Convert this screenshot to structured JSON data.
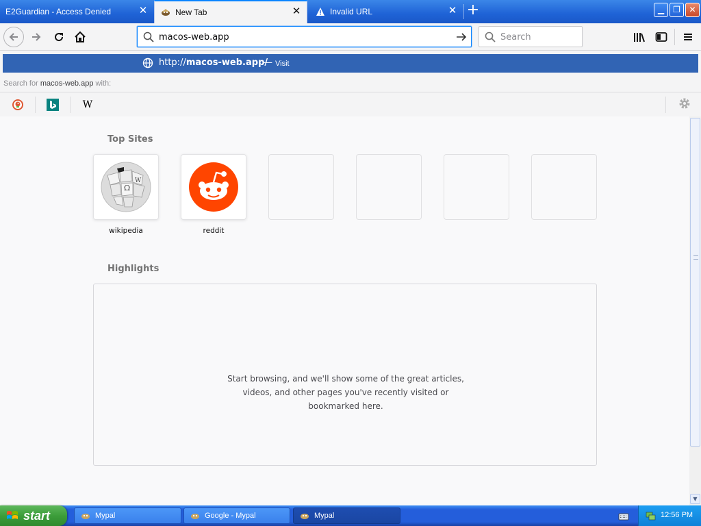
{
  "tabs": [
    {
      "title": "E2Guardian - Access Denied",
      "active": false
    },
    {
      "title": "New Tab",
      "active": true
    },
    {
      "title": "Invalid URL",
      "active": false
    }
  ],
  "window_controls": {
    "minimize": "▁",
    "restore": "❐",
    "close": "✕"
  },
  "urlbar": {
    "value": "macos-web.app"
  },
  "searchbar": {
    "placeholder": "Search"
  },
  "dropdown": {
    "suggestion_prefix": "http://",
    "suggestion_host": "macos-web.app/",
    "suggestion_dash": "—",
    "suggestion_action": "Visit",
    "search_for_prefix": "Search for",
    "search_for_query": "macos-web.app",
    "search_for_suffix": "with:",
    "engines": [
      {
        "name": "DuckDuckGo",
        "icon": "duckduckgo-icon"
      },
      {
        "name": "Bing",
        "icon": "bing-icon"
      },
      {
        "name": "Wikipedia",
        "icon": "wikipedia-icon",
        "glyph": "W"
      }
    ]
  },
  "content": {
    "top_sites_title": "Top Sites",
    "top_sites": [
      {
        "label": "wikipedia",
        "icon": "wikipedia-globe-icon"
      },
      {
        "label": "reddit",
        "icon": "reddit-icon"
      },
      {
        "label": ""
      },
      {
        "label": ""
      },
      {
        "label": ""
      },
      {
        "label": ""
      }
    ],
    "highlights_title": "Highlights",
    "highlights_message": "Start browsing, and we'll show some of the great articles, videos, and other pages you've recently visited or bookmarked here."
  },
  "taskbar": {
    "start_label": "start",
    "tasks": [
      {
        "label": "Mypal",
        "active": false
      },
      {
        "label": "Google - Mypal",
        "active": false
      },
      {
        "label": "Mypal",
        "active": true
      }
    ],
    "clock": "12:56 PM"
  },
  "colors": {
    "accent": "#0a84ff",
    "suggestion_bg": "#3164b4",
    "reddit": "#ff4500",
    "xp_blue": "#245edb",
    "start_green": "#3c9d3a"
  }
}
